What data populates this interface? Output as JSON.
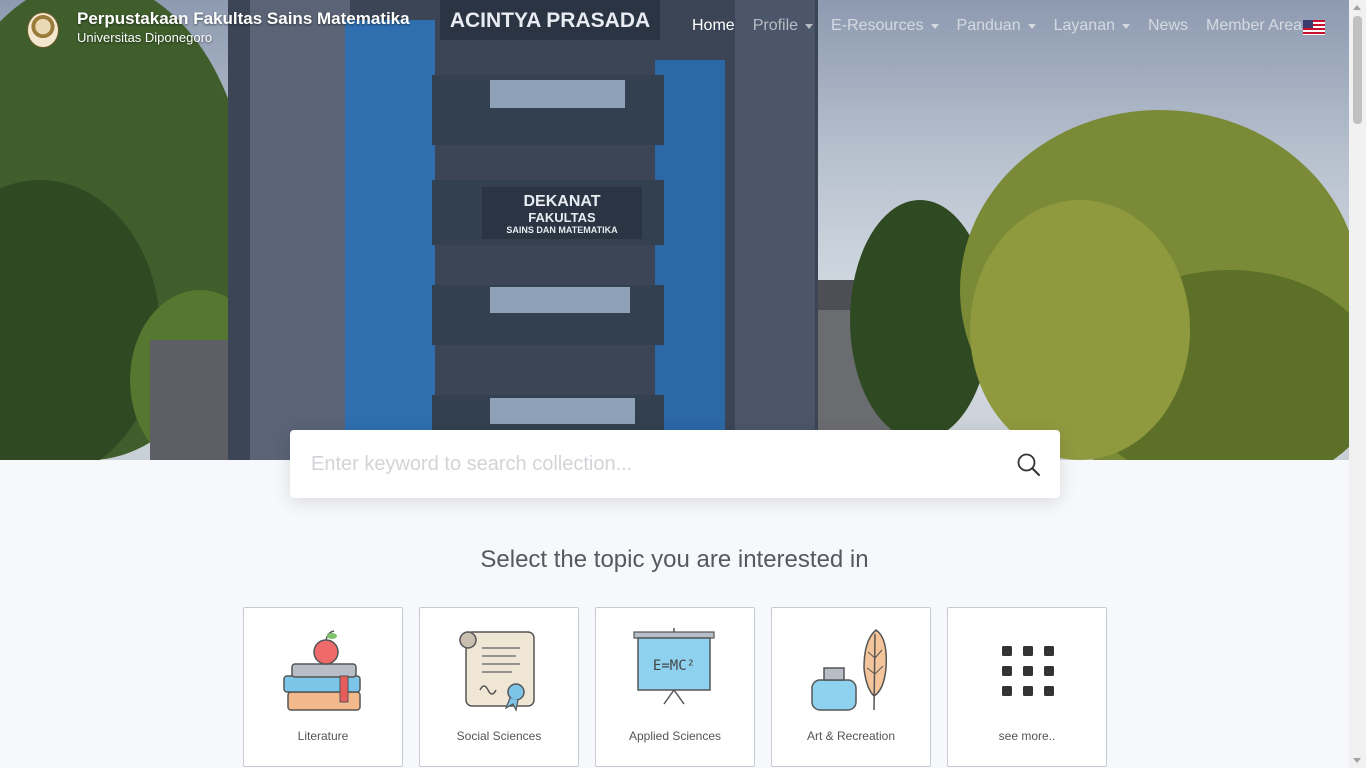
{
  "brand": {
    "title": "Perpustakaan Fakultas Sains Matematika",
    "subtitle": "Universitas Diponegoro"
  },
  "hero": {
    "building_signs": [
      "ACINTYA PRASADA",
      "DEKANAT",
      "FAKULTAS",
      "SAINS DAN MATEMATIKA"
    ]
  },
  "nav": {
    "items": [
      {
        "label": "Home",
        "active": true,
        "dropdown": false
      },
      {
        "label": "Profile",
        "active": false,
        "dropdown": true
      },
      {
        "label": "E-Resources",
        "active": false,
        "dropdown": true
      },
      {
        "label": "Panduan",
        "active": false,
        "dropdown": true
      },
      {
        "label": "Layanan",
        "active": false,
        "dropdown": true
      },
      {
        "label": "News",
        "active": false,
        "dropdown": false
      },
      {
        "label": "Member Area",
        "active": false,
        "dropdown": false
      }
    ],
    "language_icon": "us-flag-icon"
  },
  "search": {
    "placeholder": "Enter keyword to search collection...",
    "value": "",
    "icon": "search-icon"
  },
  "topics": {
    "heading": "Select the topic you are interested in",
    "items": [
      {
        "label": "Literature",
        "icon": "books-apple-icon"
      },
      {
        "label": "Social Sciences",
        "icon": "certificate-scroll-icon"
      },
      {
        "label": "Applied Sciences",
        "icon": "blackboard-formula-icon"
      },
      {
        "label": "Art & Recreation",
        "icon": "ink-feather-icon"
      },
      {
        "label": "see more..",
        "icon": "grid-dots-icon"
      }
    ],
    "formula_text": "E=MC²"
  },
  "colors": {
    "accent": "#3c3b6e",
    "page_bg": "#f6f8fb",
    "nav_active": "#ffffff"
  }
}
